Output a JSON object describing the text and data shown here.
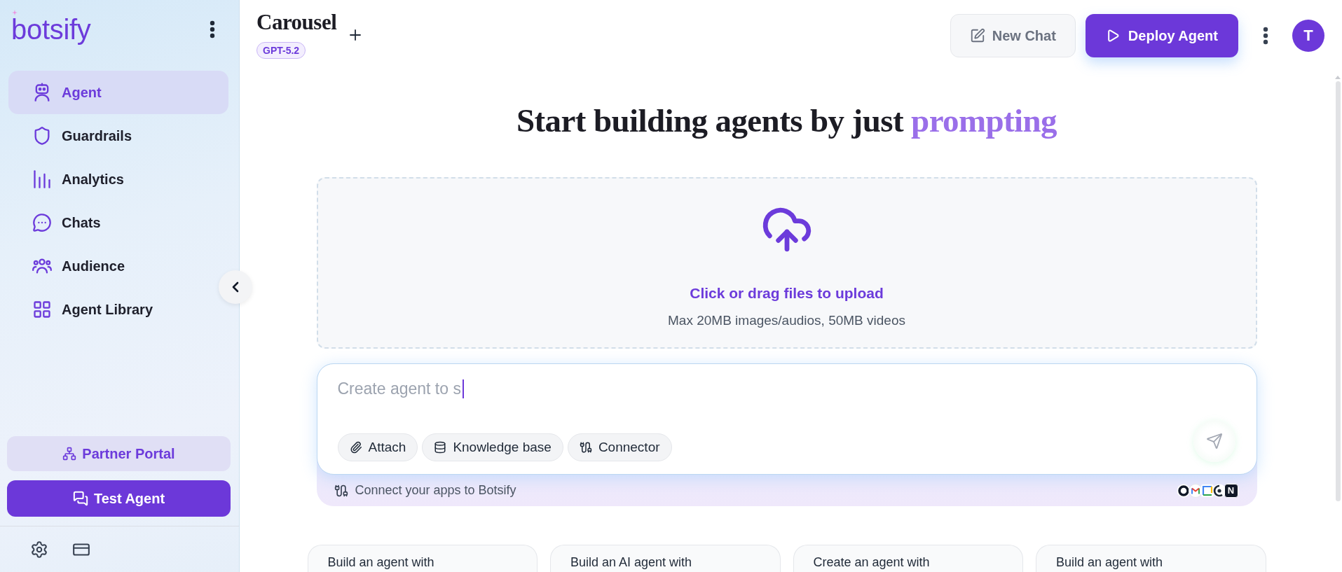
{
  "sidebar": {
    "logo": "botsify",
    "nav_items": [
      {
        "label": "Agent",
        "selected": true
      },
      {
        "label": "Guardrails",
        "selected": false
      },
      {
        "label": "Analytics",
        "selected": false
      },
      {
        "label": "Chats",
        "selected": false
      },
      {
        "label": "Audience",
        "selected": false
      },
      {
        "label": "Agent Library",
        "selected": false
      }
    ],
    "partner_button": "Partner Portal",
    "test_button": "Test Agent"
  },
  "header": {
    "title": "Carousel",
    "model_badge": "GPT-5.2",
    "new_chat_button": "New Chat",
    "deploy_button": "Deploy Agent",
    "avatar_initial": "T"
  },
  "heading": {
    "text": "Start building agents by just",
    "highlight": "prompting"
  },
  "upload": {
    "title": "Click or drag files to upload",
    "hint": "Max 20MB images/audios, 50MB videos"
  },
  "prompt": {
    "placeholder": "Create agent to s",
    "chips": [
      "Attach",
      "Knowledge base",
      "Connector"
    ],
    "footer_text": "Connect your apps to Botsify",
    "app_badge": "N"
  },
  "suggestion_cards": [
    "Build an agent with",
    "Build an AI agent with",
    "Create an agent with",
    "Build an agent with"
  ]
}
